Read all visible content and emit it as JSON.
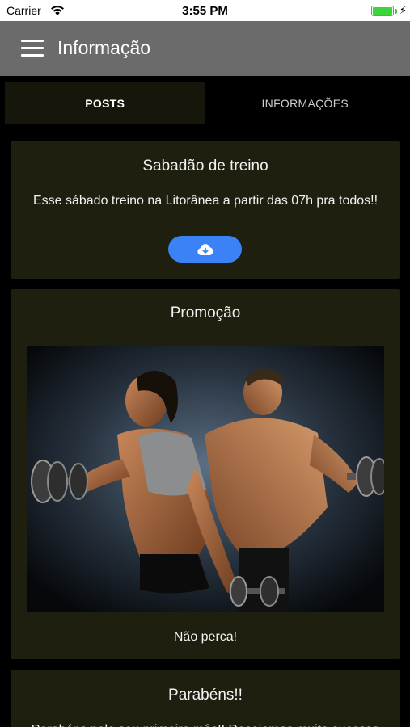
{
  "status_bar": {
    "carrier": "Carrier",
    "time": "3:55 PM"
  },
  "app_bar": {
    "title": "Informação",
    "menu_icon": "hamburger-menu-icon"
  },
  "tabs": [
    {
      "label": "POSTS",
      "active": true
    },
    {
      "label": "INFORMAÇÕES",
      "active": false
    }
  ],
  "posts": [
    {
      "title": "Sabadão de treino",
      "text": "Esse sábado treino na Litorânea a partir das 07h pra todos!!",
      "button_icon": "cloud-download-icon"
    },
    {
      "title": "Promoção",
      "image": "fitness-couple-dumbbells-photo",
      "text": "Não perca!"
    },
    {
      "title": "Parabéns!!",
      "text": "Parabéns pelo seu primeiro mês!! Desejamos muito sucesso"
    }
  ],
  "colors": {
    "app_bar": "#6b6b6b",
    "card_background": "#1e1f0e",
    "active_tab": "#16170a",
    "button": "#3b82f6",
    "battery": "#3bd43b"
  }
}
